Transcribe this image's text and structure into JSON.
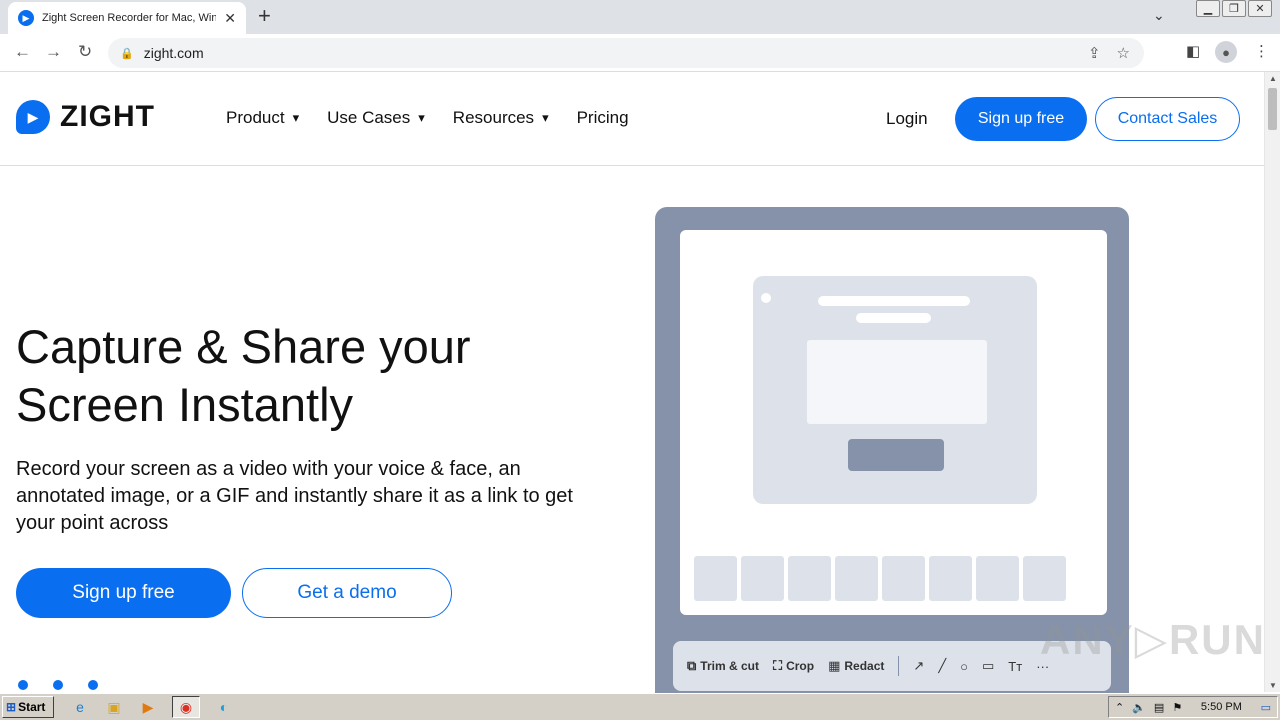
{
  "browser": {
    "tab_title": "Zight Screen Recorder for Mac, Windows",
    "tab_close": "✕",
    "new_tab": "+",
    "url": "zight.com"
  },
  "site": {
    "logo_text": "ZIGHT",
    "nav": [
      {
        "label": "Product"
      },
      {
        "label": "Use Cases"
      },
      {
        "label": "Resources"
      },
      {
        "label": "Pricing"
      }
    ],
    "login": "Login",
    "signup": "Sign up free",
    "contact": "Contact Sales"
  },
  "hero": {
    "title_line1": "Capture & Share your",
    "title_line2": "Screen Instantly",
    "subtitle": "Record your screen as a video with your voice & face, an annotated image, or a GIF and instantly share it as a link to get your point across",
    "primary_cta": "Sign up free",
    "secondary_cta": "Get a demo"
  },
  "editor": {
    "trim": "Trim & cut",
    "crop": "Crop",
    "redact": "Redact",
    "text_tool": "Tт",
    "more": "···"
  },
  "watermark": "ANY▷RUN",
  "taskbar": {
    "start": "Start",
    "time": "5:50 PM"
  },
  "colors": {
    "brand": "#0a6ef0",
    "illustration": "#8592aa"
  }
}
